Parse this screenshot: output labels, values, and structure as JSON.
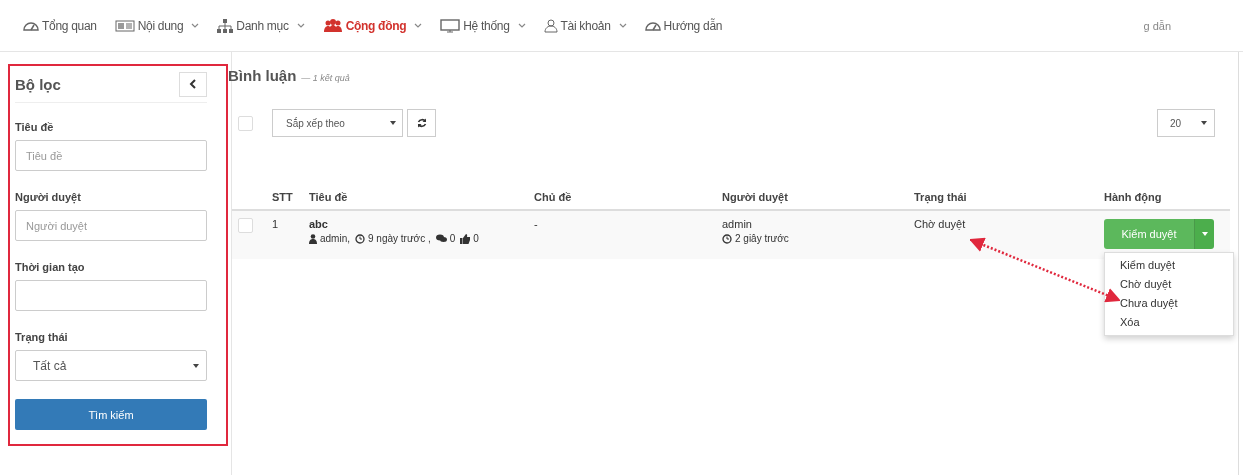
{
  "nav": {
    "items": [
      {
        "label": "Tổng quan",
        "has_caret": false,
        "selected": false
      },
      {
        "label": "Nội dung",
        "has_caret": true,
        "selected": false
      },
      {
        "label": "Danh mục",
        "has_caret": true,
        "selected": false
      },
      {
        "label": "Cộng đồng",
        "has_caret": true,
        "selected": true
      },
      {
        "label": "Hệ thống",
        "has_caret": true,
        "selected": false
      },
      {
        "label": "Tài khoản",
        "has_caret": true,
        "selected": false
      },
      {
        "label": "Hướng dẫn",
        "has_caret": false,
        "selected": false
      }
    ],
    "overflow_text": "g dẫn"
  },
  "filter": {
    "title": "Bộ lọc",
    "fields": [
      {
        "kind": "text",
        "label": "Tiêu đề",
        "placeholder": "Tiêu đề"
      },
      {
        "kind": "text",
        "label": "Người duyệt",
        "placeholder": "Người duyệt"
      },
      {
        "kind": "text",
        "label": "Thời gian tạo"
      },
      {
        "kind": "select",
        "label": "Trạng thái",
        "value": "Tất cả"
      }
    ],
    "search_button": "Tìm kiếm"
  },
  "list": {
    "title": "Bình luận",
    "result_count": "— 1 kết quả",
    "select_all_checked": false,
    "sort_placeholder": "Sắp xếp theo",
    "page_size": "20",
    "columns": [
      "STT",
      "Tiêu đề",
      "Chủ đề",
      "Người duyệt",
      "Trạng thái",
      "Hành động"
    ],
    "rows": [
      {
        "checked": false,
        "index": "1",
        "title": "abc",
        "author": "admin,",
        "created": "9 ngày trước ,",
        "comments": "0",
        "likes": "0",
        "topic": "-",
        "reviewer": "admin",
        "reviewed": "2 giây trước",
        "status": "Chờ duyệt",
        "action": "Kiểm duyệt",
        "menu": [
          "Kiểm duyệt",
          "Chờ duyệt",
          "Chưa duyệt",
          "Xóa"
        ]
      }
    ]
  }
}
